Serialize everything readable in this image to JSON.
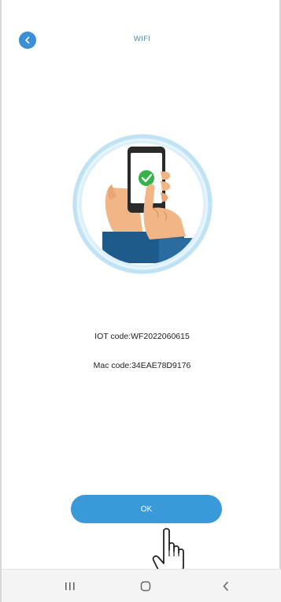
{
  "header": {
    "title": "WIFI",
    "back_icon": "chevron-left-icon"
  },
  "illustration": {
    "icon": "phone-check-illustration"
  },
  "info": {
    "iot_code": "IOT code:WF2022060615",
    "mac_code": "Mac code:34EAE78D9176"
  },
  "actions": {
    "ok_label": "OK"
  },
  "nav": {
    "recent_icon": "recent-apps-icon",
    "home_icon": "home-icon",
    "back_icon": "back-icon"
  },
  "colors": {
    "accent": "#3a8fd6",
    "button": "#3a9ad9",
    "ring": "#bfe3f5"
  }
}
